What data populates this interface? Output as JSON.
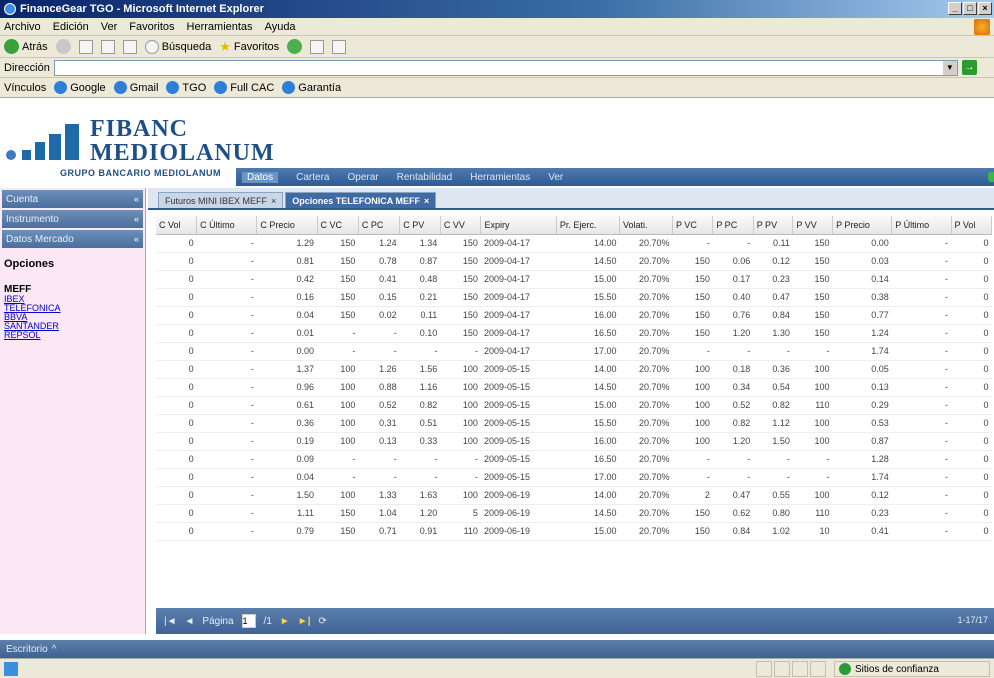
{
  "window": {
    "title": "FinanceGear TGO - Microsoft Internet Explorer"
  },
  "menu": [
    "Archivo",
    "Edición",
    "Ver",
    "Favoritos",
    "Herramientas",
    "Ayuda"
  ],
  "toolbar": {
    "back": "Atrás",
    "search": "Búsqueda",
    "favorites": "Favoritos"
  },
  "address": {
    "label": "Dirección",
    "go": "Ir"
  },
  "links": {
    "label": "Vínculos",
    "items": [
      "Google",
      "Gmail",
      "TGO",
      "Full CAC",
      "Garantía"
    ]
  },
  "logo": {
    "line1": "FIBANC",
    "line2": "MEDIOLANUM",
    "tagline": "GRUPO BANCARIO MEDIOLANUM"
  },
  "nav": [
    "Datos",
    "Cartera",
    "Operar",
    "Rentabilidad",
    "Herramientas",
    "Ver"
  ],
  "sidebar": {
    "buttons": [
      "Cuenta",
      "Instrumento",
      "Datos Mercado"
    ],
    "section_title": "Opciones",
    "group": "MEFF",
    "links": [
      "IBEX",
      "TELEFONICA",
      "BBVA",
      "SANTANDER",
      "REPSOL"
    ]
  },
  "tabs": [
    {
      "label": "Futuros MINI IBEX MEFF"
    },
    {
      "label": "Opciones TELEFONICA MEFF"
    }
  ],
  "table": {
    "columns": [
      "C Vol",
      "C Último",
      "C Precio",
      "C VC",
      "C PC",
      "C PV",
      "C VV",
      "Expiry",
      "Pr. Ejerc.",
      "Volati.",
      "P VC",
      "P PC",
      "P PV",
      "P VV",
      "P Precio",
      "P Último",
      "P Vol"
    ],
    "rows": [
      [
        "0",
        "-",
        "1.29",
        "150",
        "1.24",
        "1.34",
        "150",
        "2009-04-17",
        "14.00",
        "20.70%",
        "-",
        "-",
        "0.11",
        "150",
        "0.00",
        "-",
        "0"
      ],
      [
        "0",
        "-",
        "0.81",
        "150",
        "0.78",
        "0.87",
        "150",
        "2009-04-17",
        "14.50",
        "20.70%",
        "150",
        "0.06",
        "0.12",
        "150",
        "0.03",
        "-",
        "0"
      ],
      [
        "0",
        "-",
        "0.42",
        "150",
        "0.41",
        "0.48",
        "150",
        "2009-04-17",
        "15.00",
        "20.70%",
        "150",
        "0.17",
        "0.23",
        "150",
        "0.14",
        "-",
        "0"
      ],
      [
        "0",
        "-",
        "0.16",
        "150",
        "0.15",
        "0.21",
        "150",
        "2009-04-17",
        "15.50",
        "20.70%",
        "150",
        "0.40",
        "0.47",
        "150",
        "0.38",
        "-",
        "0"
      ],
      [
        "0",
        "-",
        "0.04",
        "150",
        "0.02",
        "0.11",
        "150",
        "2009-04-17",
        "16.00",
        "20.70%",
        "150",
        "0.76",
        "0.84",
        "150",
        "0.77",
        "-",
        "0"
      ],
      [
        "0",
        "-",
        "0.01",
        "-",
        "-",
        "0.10",
        "150",
        "2009-04-17",
        "16.50",
        "20.70%",
        "150",
        "1.20",
        "1.30",
        "150",
        "1.24",
        "-",
        "0"
      ],
      [
        "0",
        "-",
        "0.00",
        "-",
        "-",
        "-",
        "-",
        "2009-04-17",
        "17.00",
        "20.70%",
        "-",
        "-",
        "-",
        "-",
        "1.74",
        "-",
        "0"
      ],
      [
        "0",
        "-",
        "1.37",
        "100",
        "1.26",
        "1.56",
        "100",
        "2009-05-15",
        "14.00",
        "20.70%",
        "100",
        "0.18",
        "0.36",
        "100",
        "0.05",
        "-",
        "0"
      ],
      [
        "0",
        "-",
        "0.96",
        "100",
        "0.88",
        "1.16",
        "100",
        "2009-05-15",
        "14.50",
        "20.70%",
        "100",
        "0.34",
        "0.54",
        "100",
        "0.13",
        "-",
        "0"
      ],
      [
        "0",
        "-",
        "0.61",
        "100",
        "0.52",
        "0.82",
        "100",
        "2009-05-15",
        "15.00",
        "20.70%",
        "100",
        "0.52",
        "0.82",
        "110",
        "0.29",
        "-",
        "0"
      ],
      [
        "0",
        "-",
        "0.36",
        "100",
        "0.31",
        "0.51",
        "100",
        "2009-05-15",
        "15.50",
        "20.70%",
        "100",
        "0.82",
        "1.12",
        "100",
        "0.53",
        "-",
        "0"
      ],
      [
        "0",
        "-",
        "0.19",
        "100",
        "0.13",
        "0.33",
        "100",
        "2009-05-15",
        "16.00",
        "20.70%",
        "100",
        "1.20",
        "1.50",
        "100",
        "0.87",
        "-",
        "0"
      ],
      [
        "0",
        "-",
        "0.09",
        "-",
        "-",
        "-",
        "-",
        "2009-05-15",
        "16.50",
        "20.70%",
        "-",
        "-",
        "-",
        "-",
        "1.28",
        "-",
        "0"
      ],
      [
        "0",
        "-",
        "0.04",
        "-",
        "-",
        "-",
        "-",
        "2009-05-15",
        "17.00",
        "20.70%",
        "-",
        "-",
        "-",
        "-",
        "1.74",
        "-",
        "0"
      ],
      [
        "0",
        "-",
        "1.50",
        "100",
        "1.33",
        "1.63",
        "100",
        "2009-06-19",
        "14.00",
        "20.70%",
        "2",
        "0.47",
        "0.55",
        "100",
        "0.12",
        "-",
        "0"
      ],
      [
        "0",
        "-",
        "1.11",
        "150",
        "1.04",
        "1.20",
        "5",
        "2009-06-19",
        "14.50",
        "20.70%",
        "150",
        "0.62",
        "0.80",
        "110",
        "0.23",
        "-",
        "0"
      ],
      [
        "0",
        "-",
        "0.79",
        "150",
        "0.71",
        "0.91",
        "110",
        "2009-06-19",
        "15.00",
        "20.70%",
        "150",
        "0.84",
        "1.02",
        "10",
        "0.41",
        "-",
        "0"
      ]
    ]
  },
  "pager": {
    "page_label": "Página",
    "page": "1",
    "of": "/1",
    "range": "1-17/17"
  },
  "bottom": {
    "label": "Escritorio"
  },
  "status": {
    "zone": "Sitios de confianza"
  }
}
